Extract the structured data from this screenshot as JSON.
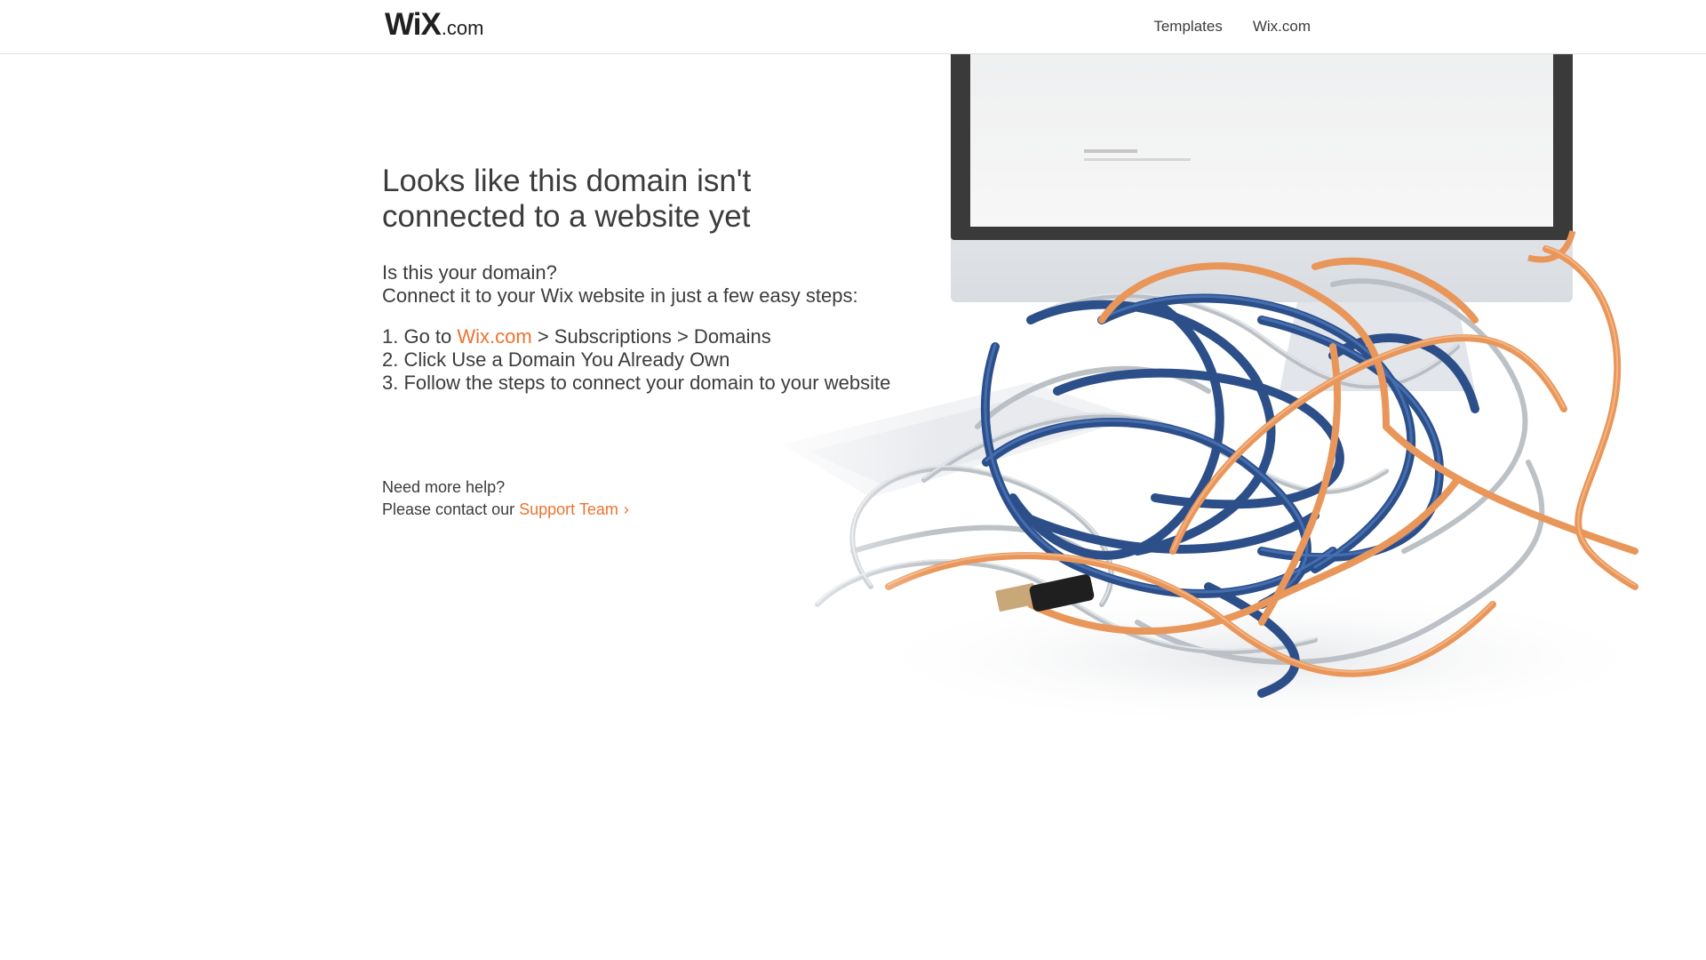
{
  "header": {
    "logo_main": "WiX",
    "logo_suffix": ".com",
    "nav": [
      "Templates",
      "Wix.com"
    ]
  },
  "main": {
    "title_line1": "Looks like this domain isn't",
    "title_line2": "connected to a website yet",
    "intro_line1": "Is this your domain?",
    "intro_line2": "Connect it to your Wix website in just a few easy steps:",
    "steps": {
      "step1_prefix": "1. Go to ",
      "step1_link": "Wix.com",
      "step1_suffix": " > Subscriptions > Domains",
      "step2": "2. Click Use a Domain You Already Own",
      "step3": "3. Follow the steps to connect your domain to your website"
    },
    "help_line": "Need more help?",
    "contact_prefix": "Please contact our ",
    "contact_link": "Support Team",
    "contact_chevron": "›"
  },
  "colors": {
    "accent": "#ec7330",
    "text": "#3c3c3c",
    "header_border": "#dedede",
    "cable_blue": "#2c4f8a",
    "cable_orange": "#e9965a",
    "cable_silver": "#b9bec4"
  },
  "hero_image": "tangled-cables-and-computer-illustration"
}
